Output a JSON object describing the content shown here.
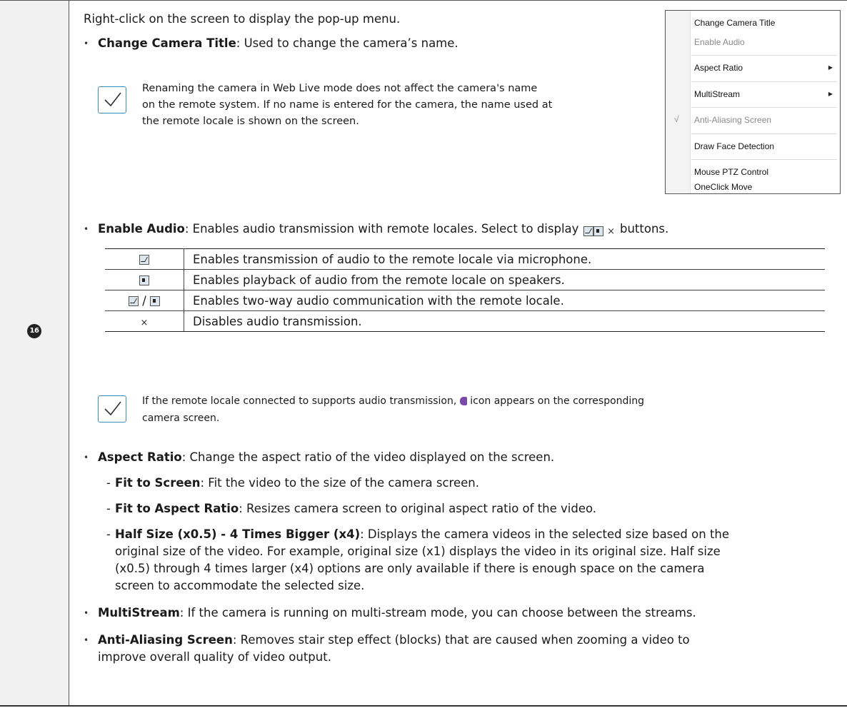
{
  "row_number": "16",
  "intro": "Right-click on the screen to display the pop-up menu.",
  "change_title": {
    "term": "Change Camera Title",
    "desc": ": Used to change the camera’s name."
  },
  "note1": {
    "line1": "Renaming the camera in Web Live mode does not affect the camera's name",
    "line2": "on the remote system. If no name is entered for the camera, the name used at",
    "line3": "the remote locale is shown on the screen."
  },
  "menu": {
    "items": [
      {
        "label": "Change Camera Title",
        "enabled": true
      },
      {
        "label": "Enable Audio",
        "enabled": false
      },
      {
        "label": "Aspect Ratio",
        "enabled": true,
        "submenu": true
      },
      {
        "label": "MultiStream",
        "enabled": true,
        "submenu": true
      },
      {
        "label": "Anti-Aliasing Screen",
        "enabled": false,
        "checked": true
      },
      {
        "label": "Draw Face Detection",
        "enabled": true
      },
      {
        "label": "Mouse PTZ Control",
        "enabled": true
      },
      {
        "label": "OneClick Move",
        "enabled": true
      }
    ],
    "check_glyph": "√",
    "arrow_glyph": "▶"
  },
  "enable_audio": {
    "term": "Enable Audio",
    "desc_a": ": Enables audio transmission with remote locales. Select to display",
    "desc_b": "buttons."
  },
  "audio_table": [
    {
      "icon": "mic-icon",
      "text": "Enables transmission of audio to the remote locale via microphone."
    },
    {
      "icon": "speaker-icon",
      "text": "Enables playback of audio from the remote locale on speakers."
    },
    {
      "icon": "mic-speaker-icon",
      "text": "Enables two-way audio communication with the remote locale."
    },
    {
      "icon": "close-icon",
      "text": "Disables audio transmission."
    }
  ],
  "note2": {
    "line1a": "If the remote locale connected to supports audio transmission,",
    "line1b": "icon appears on the corresponding",
    "line2": "camera screen."
  },
  "aspect": {
    "term": "Aspect Ratio",
    "desc": ": Change the aspect ratio of the video displayed on the screen."
  },
  "fit_screen": {
    "term": "Fit to Screen",
    "desc": ": Fit the video to the size of the camera screen."
  },
  "fit_aspect": {
    "term": "Fit to Aspect Ratio",
    "desc": ": Resizes camera screen to original aspect ratio of the video."
  },
  "half_size": {
    "term": "Half Size (x0.5) - 4 Times Bigger (x4)",
    "desc": ": Displays the camera videos in the selected size based on the",
    "line2": "original size of the video. For example, original size (x1) displays the video in its original size. Half size",
    "line3": "(x0.5) through 4 times larger (x4) options are only available if there is enough space on the camera",
    "line4": "screen to accommodate the selected size."
  },
  "multistream": {
    "term": "MultiStream",
    "desc": ": If the camera is running on multi-stream mode, you can choose between the streams."
  },
  "antialias": {
    "term": "Anti-Aliasing Screen",
    "desc": ": Removes stair step effect (blocks) that are caused when zooming a video to",
    "line2": "improve overall quality of video output."
  },
  "slash": "/",
  "x_glyph": "×",
  "dash": "-",
  "bullet": "•"
}
